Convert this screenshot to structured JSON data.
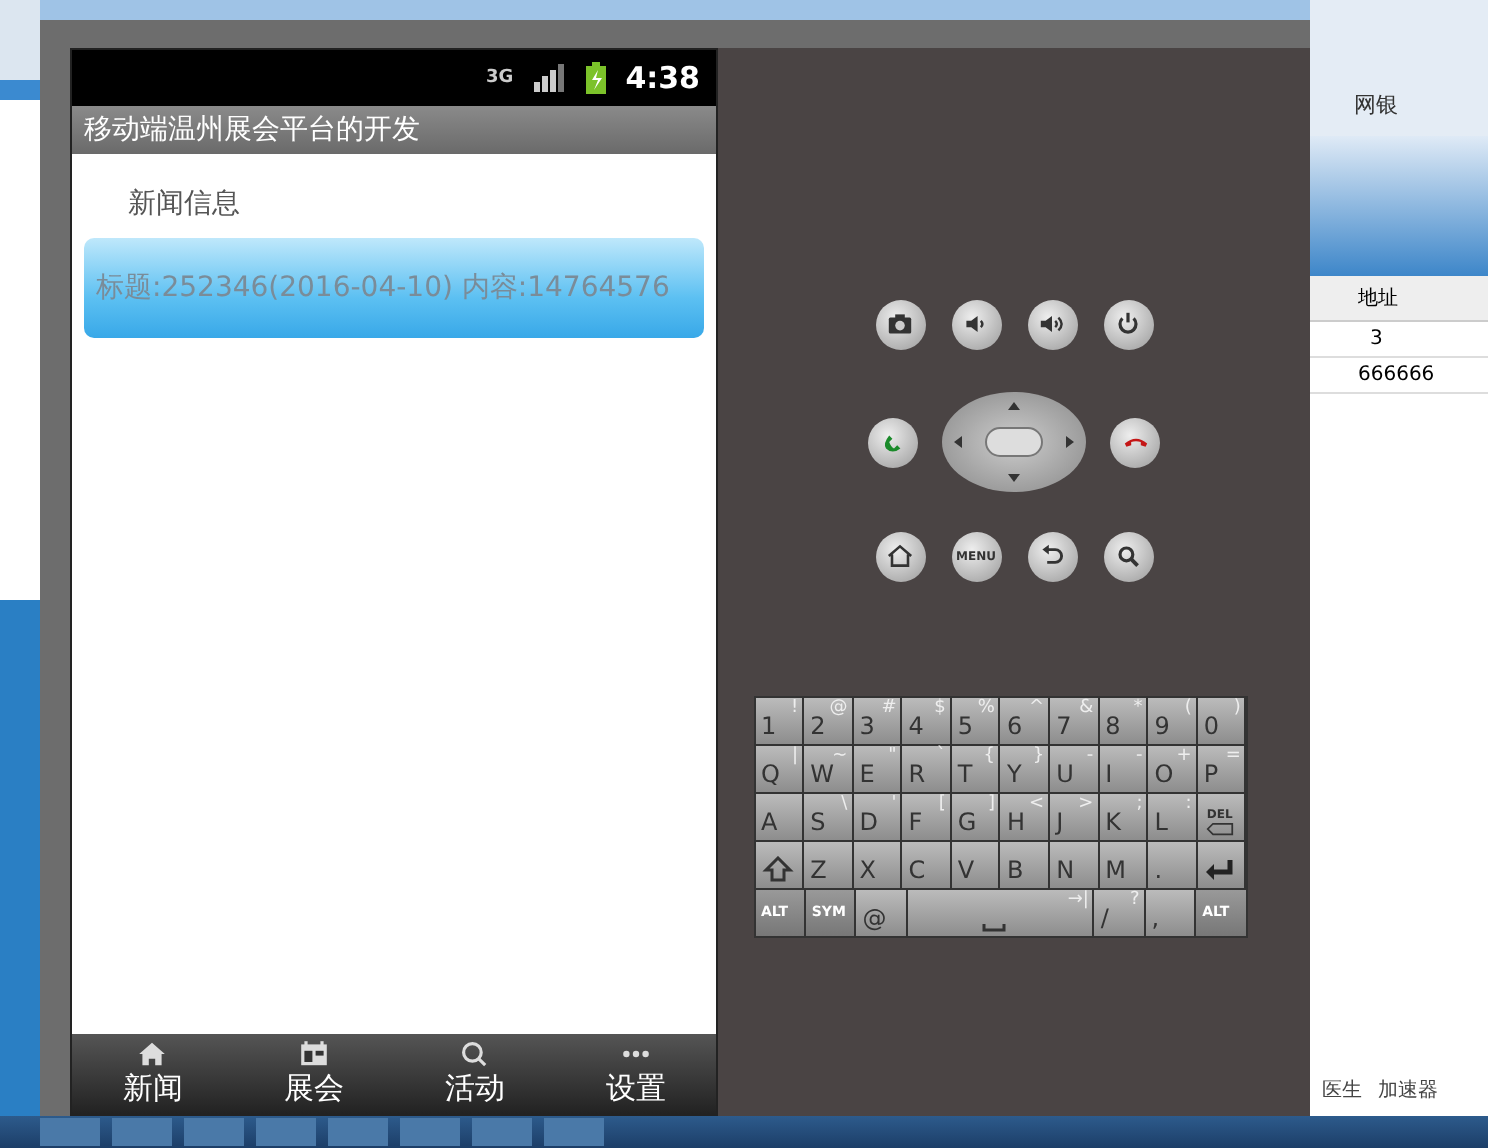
{
  "phone": {
    "status_bar": {
      "network": "3G",
      "time": "4:38"
    },
    "app_title": "移动端温州展会平台的开发",
    "section_title": "新闻信息",
    "news_items": [
      {
        "text": "标题:252346(2016-04-10) 内容:14764576",
        "selected": true
      }
    ],
    "tabs": [
      {
        "label": "新闻"
      },
      {
        "label": "展会"
      },
      {
        "label": "活动"
      },
      {
        "label": "设置"
      }
    ]
  },
  "hardware_buttons": [
    [
      {
        "kind": "camera"
      },
      {
        "kind": "volume-down"
      },
      {
        "kind": "volume-up"
      },
      {
        "kind": "power"
      }
    ],
    [
      {
        "kind": "call"
      },
      {
        "kind": "dpad"
      },
      {
        "kind": "end-call"
      }
    ],
    [
      {
        "kind": "home"
      },
      {
        "kind": "menu",
        "label": "MENU"
      },
      {
        "kind": "back"
      },
      {
        "kind": "search"
      }
    ]
  ],
  "keyboard": [
    [
      {
        "kind": "char",
        "label": "1",
        "alt": "!"
      },
      {
        "kind": "char",
        "label": "2",
        "alt": "@"
      },
      {
        "kind": "char",
        "label": "3",
        "alt": "#"
      },
      {
        "kind": "char",
        "label": "4",
        "alt": "$"
      },
      {
        "kind": "char",
        "label": "5",
        "alt": "%"
      },
      {
        "kind": "char",
        "label": "6",
        "alt": "^"
      },
      {
        "kind": "char",
        "label": "7",
        "alt": "&"
      },
      {
        "kind": "char",
        "label": "8",
        "alt": "*"
      },
      {
        "kind": "char",
        "label": "9",
        "alt": "("
      },
      {
        "kind": "char",
        "label": "0",
        "alt": ")"
      }
    ],
    [
      {
        "kind": "char",
        "label": "Q",
        "alt": "|"
      },
      {
        "kind": "char",
        "label": "W",
        "alt": "~"
      },
      {
        "kind": "char",
        "label": "E",
        "alt": "\""
      },
      {
        "kind": "char",
        "label": "R",
        "alt": "`"
      },
      {
        "kind": "char",
        "label": "T",
        "alt": "{"
      },
      {
        "kind": "char",
        "label": "Y",
        "alt": "}"
      },
      {
        "kind": "char",
        "label": "U",
        "alt": "-"
      },
      {
        "kind": "char",
        "label": "I",
        "alt": "-"
      },
      {
        "kind": "char",
        "label": "O",
        "alt": "+"
      },
      {
        "kind": "char",
        "label": "P",
        "alt": "="
      }
    ],
    [
      {
        "kind": "char",
        "label": "A"
      },
      {
        "kind": "char",
        "label": "S",
        "alt": "\\"
      },
      {
        "kind": "char",
        "label": "D",
        "alt": "'"
      },
      {
        "kind": "char",
        "label": "F",
        "alt": "["
      },
      {
        "kind": "char",
        "label": "G",
        "alt": "]"
      },
      {
        "kind": "char",
        "label": "H",
        "alt": "<"
      },
      {
        "kind": "char",
        "label": "J",
        "alt": ">"
      },
      {
        "kind": "char",
        "label": "K",
        "alt": ";"
      },
      {
        "kind": "char",
        "label": "L",
        "alt": ":"
      },
      {
        "kind": "del",
        "label": "DEL"
      }
    ],
    [
      {
        "kind": "shift"
      },
      {
        "kind": "char",
        "label": "Z"
      },
      {
        "kind": "char",
        "label": "X"
      },
      {
        "kind": "char",
        "label": "C"
      },
      {
        "kind": "char",
        "label": "V"
      },
      {
        "kind": "char",
        "label": "B"
      },
      {
        "kind": "char",
        "label": "N"
      },
      {
        "kind": "char",
        "label": "M"
      },
      {
        "kind": "char",
        "label": "."
      },
      {
        "kind": "enter"
      }
    ],
    [
      {
        "kind": "small",
        "label": "ALT"
      },
      {
        "kind": "small",
        "label": "SYM"
      },
      {
        "kind": "char",
        "label": "@"
      },
      {
        "kind": "space",
        "alt": "→|"
      },
      {
        "kind": "char",
        "label": "/",
        "alt": "?"
      },
      {
        "kind": "char",
        "label": ","
      },
      {
        "kind": "small",
        "label": "ALT"
      }
    ]
  ],
  "background_browser": {
    "toolbar_link": "网银",
    "table_header": "地址",
    "table_cells": [
      "3",
      "666666"
    ],
    "status_items": [
      "医生",
      "加速器"
    ]
  }
}
